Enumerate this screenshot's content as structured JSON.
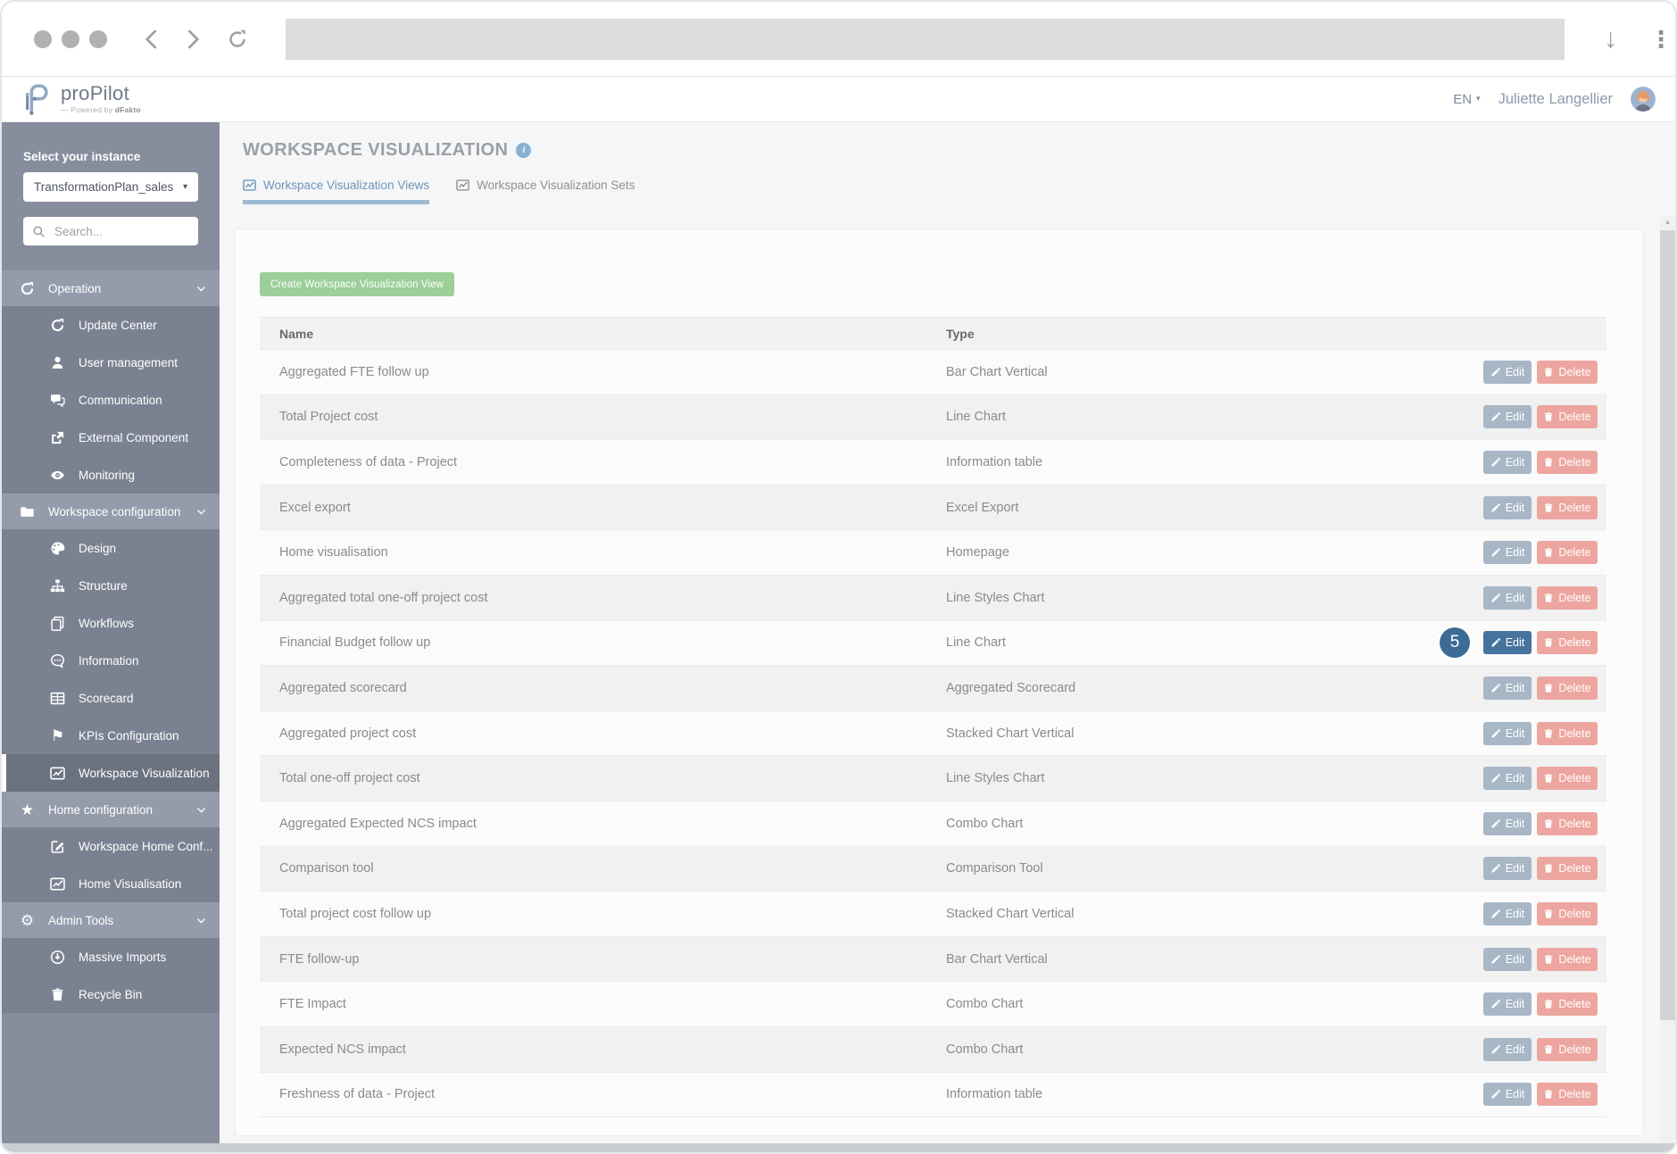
{
  "browser": {
    "url_value": ""
  },
  "header": {
    "logo_title": "proPilot",
    "logo_subtitle_prefix": "— Powered by",
    "logo_subtitle_brand": "dFakto",
    "language": "EN",
    "user_name": "Juliette Langellier"
  },
  "sidebar": {
    "instance_label": "Select your instance",
    "instance_value": "TransformationPlan_sales",
    "search_placeholder": "Search...",
    "sections": [
      {
        "label": "Operation",
        "icon": "refresh-icon",
        "items": [
          {
            "label": "Update Center",
            "icon": "refresh-icon"
          },
          {
            "label": "User management",
            "icon": "user-icon"
          },
          {
            "label": "Communication",
            "icon": "chat-icon"
          },
          {
            "label": "External Component",
            "icon": "external-icon"
          },
          {
            "label": "Monitoring",
            "icon": "eye-icon"
          }
        ]
      },
      {
        "label": "Workspace configuration",
        "icon": "folder-icon",
        "items": [
          {
            "label": "Design",
            "icon": "palette-icon"
          },
          {
            "label": "Structure",
            "icon": "sitemap-icon"
          },
          {
            "label": "Workflows",
            "icon": "copy-icon"
          },
          {
            "label": "Information",
            "icon": "info-bubble-icon"
          },
          {
            "label": "Scorecard",
            "icon": "table-icon"
          },
          {
            "label": "KPIs Configuration",
            "icon": "flag-icon"
          },
          {
            "label": "Workspace Visualization",
            "icon": "chart-icon",
            "active": true
          }
        ]
      },
      {
        "label": "Home configuration",
        "icon": "star-icon",
        "items": [
          {
            "label": "Workspace Home Conf...",
            "icon": "edit-square-icon"
          },
          {
            "label": "Home Visualisation",
            "icon": "chart-icon"
          }
        ]
      },
      {
        "label": "Admin Tools",
        "icon": "gear-icon",
        "items": [
          {
            "label": "Massive Imports",
            "icon": "download-circle-icon"
          },
          {
            "label": "Recycle Bin",
            "icon": "trash-icon"
          }
        ]
      }
    ]
  },
  "main": {
    "title": "WORKSPACE VISUALIZATION",
    "tabs": [
      {
        "label": "Workspace Visualization Views",
        "active": true
      },
      {
        "label": "Workspace Visualization Sets",
        "active": false
      }
    ],
    "create_button": "Create Workspace Visualization View",
    "table": {
      "columns": [
        "Name",
        "Type"
      ],
      "edit_label": "Edit",
      "delete_label": "Delete",
      "rows": [
        {
          "name": "Aggregated FTE follow up",
          "type": "Bar Chart Vertical"
        },
        {
          "name": "Total Project cost",
          "type": "Line Chart"
        },
        {
          "name": "Completeness of data - Project",
          "type": "Information table"
        },
        {
          "name": "Excel export",
          "type": "Excel Export"
        },
        {
          "name": "Home visualisation",
          "type": "Homepage"
        },
        {
          "name": "Aggregated total one-off project cost",
          "type": "Line Styles Chart"
        },
        {
          "name": "Financial Budget follow up",
          "type": "Line Chart",
          "badge": "5",
          "highlighted": true
        },
        {
          "name": "Aggregated scorecard",
          "type": "Aggregated Scorecard"
        },
        {
          "name": "Aggregated project cost",
          "type": "Stacked Chart Vertical"
        },
        {
          "name": "Total one-off project cost",
          "type": "Line Styles Chart"
        },
        {
          "name": "Aggregated Expected NCS impact",
          "type": "Combo Chart"
        },
        {
          "name": "Comparison tool",
          "type": "Comparison Tool"
        },
        {
          "name": "Total project cost follow up",
          "type": "Stacked Chart Vertical"
        },
        {
          "name": "FTE follow-up",
          "type": "Bar Chart Vertical"
        },
        {
          "name": "FTE Impact",
          "type": "Combo Chart"
        },
        {
          "name": "Expected NCS impact",
          "type": "Combo Chart"
        },
        {
          "name": "Freshness of data - Project",
          "type": "Information table"
        }
      ]
    }
  },
  "colors": {
    "sidebar": "#868e9e",
    "sidebar_section_header": "#949cab",
    "sidebar_submenu": "#7a8291",
    "sidebar_active_item": "#6a7280",
    "accent_green_button": "#9ccf99",
    "edit_button_muted": "#a8b7c6",
    "edit_button_highlight": "#45739d",
    "delete_button": "#eda69f",
    "step_badge": "#3c6b96",
    "tab_active": "#6d95b9",
    "info_icon": "#87b1d3"
  }
}
